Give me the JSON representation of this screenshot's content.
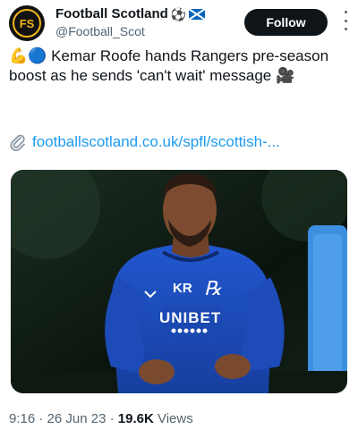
{
  "account": {
    "display_name": "Football Scotland",
    "name_emojis": "⚽",
    "handle": "@Football_Scot",
    "avatar_text": "FS"
  },
  "follow_label": "Follow",
  "tweet": {
    "emoji_prefix": "💪🔵",
    "text": "Kemar Roofe hands Rangers pre-season boost as he sends 'can't wait' message",
    "emoji_suffix": "🎥"
  },
  "link": {
    "icon": "paperclip-icon",
    "text": "footballscotland.co.uk/spfl/scottish-..."
  },
  "media": {
    "shirt_initials": "KR",
    "shirt_sponsor": "UNIBET"
  },
  "meta": {
    "time": "9:16",
    "date": "26 Jun 23",
    "views_count": "19.6K",
    "views_label": "Views"
  },
  "colors": {
    "link": "#1d9bf0",
    "follow_bg": "#0f1419",
    "secondary_text": "#536471",
    "shirt_blue": "#1a4fc2"
  }
}
